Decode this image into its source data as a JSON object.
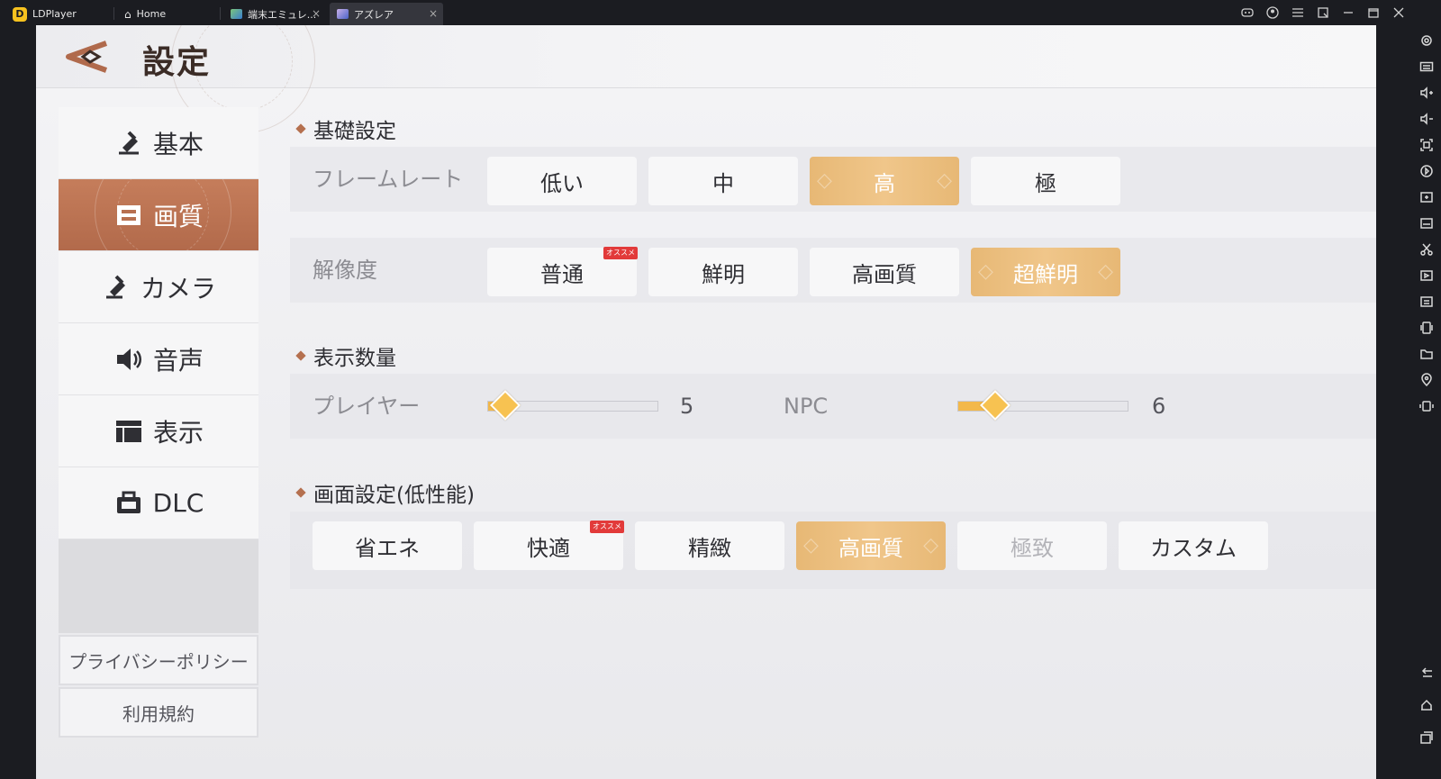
{
  "titlebar": {
    "app_name": "LDPlayer",
    "tabs": [
      {
        "label": "Home"
      },
      {
        "label": "端末エミュレ..."
      },
      {
        "label": "アズレア"
      }
    ],
    "close_glyph": "×"
  },
  "game": {
    "page_title": "設定",
    "menu": [
      {
        "label": "基本",
        "icon": "hammer-icon"
      },
      {
        "label": "画質",
        "icon": "image-icon"
      },
      {
        "label": "カメラ",
        "icon": "camera-icon"
      },
      {
        "label": "音声",
        "icon": "speaker-icon"
      },
      {
        "label": "表示",
        "icon": "display-icon"
      },
      {
        "label": "DLC",
        "icon": "package-icon"
      }
    ],
    "active_menu": "画質",
    "links": {
      "privacy": "プライバシーポリシー",
      "terms": "利用規約"
    },
    "sections": {
      "basic": {
        "title": "基礎設定",
        "framerate": {
          "label": "フレームレート",
          "options": [
            "低い",
            "中",
            "高",
            "極"
          ],
          "selected": "高"
        },
        "resolution": {
          "label": "解像度",
          "options": [
            "普通",
            "鮮明",
            "高画質",
            "超鮮明"
          ],
          "recommended_badge": "オススメ",
          "selected": "超鮮明"
        }
      },
      "display_count": {
        "title": "表示数量",
        "player": {
          "label": "プレイヤー",
          "value": "5",
          "fraction": 0.1
        },
        "npc": {
          "label": "NPC",
          "value": "6",
          "fraction": 0.22
        }
      },
      "screen": {
        "title": "画面設定(低性能)",
        "options": [
          "省エネ",
          "快適",
          "精緻",
          "高画質",
          "極致",
          "カスタム"
        ],
        "recommended_badge": "オススメ",
        "selected": "高画質",
        "disabled": "極致"
      }
    }
  },
  "colors": {
    "accent_active_menu": "#b87050",
    "selected_option": "#efc384",
    "slider_fill": "#f3b84a",
    "badge": "#e23a3a"
  }
}
